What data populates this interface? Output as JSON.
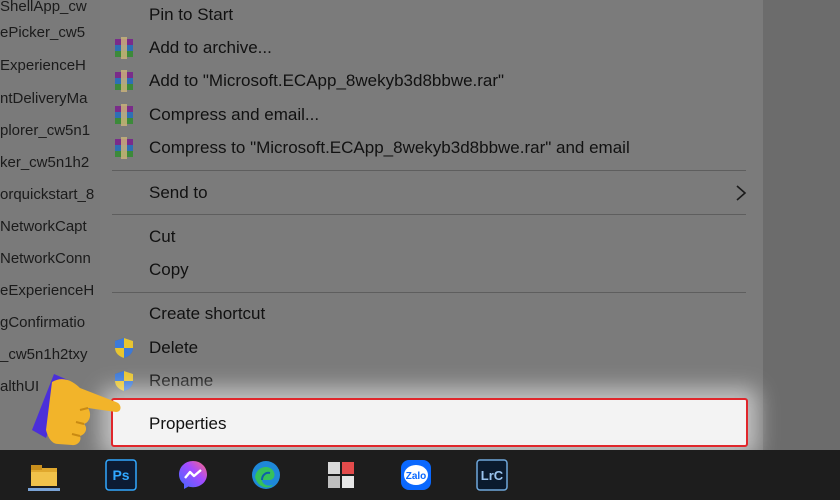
{
  "explorer": {
    "files": [
      "ShellApp_cw",
      "ePicker_cw5",
      "ExperienceH",
      "ntDeliveryMa",
      "plorer_cw5n1",
      "ker_cw5n1h2",
      "orquickstart_8",
      "NetworkCapt",
      "NetworkConn",
      "eExperienceH",
      "gConfirmatio",
      "_cw5n1h2txy",
      "althUI"
    ]
  },
  "context_menu": {
    "items": [
      {
        "label": "Pin to Start",
        "icon": "none"
      },
      {
        "label": "Add to archive...",
        "icon": "winrar-icon"
      },
      {
        "label": "Add to \"Microsoft.ECApp_8wekyb3d8bbwe.rar\"",
        "icon": "winrar-icon"
      },
      {
        "label": "Compress and email...",
        "icon": "winrar-icon"
      },
      {
        "label": "Compress to \"Microsoft.ECApp_8wekyb3d8bbwe.rar\" and email",
        "icon": "winrar-icon"
      },
      {
        "label": "Send to",
        "icon": "none",
        "submenu": true
      },
      {
        "label": "Cut",
        "icon": "none"
      },
      {
        "label": "Copy",
        "icon": "none"
      },
      {
        "label": "Create shortcut",
        "icon": "none"
      },
      {
        "label": "Delete",
        "icon": "uac-shield-icon"
      },
      {
        "label": "Rename",
        "icon": "uac-shield-icon"
      }
    ],
    "highlighted": {
      "label": "Properties"
    }
  },
  "taskbar": {
    "icons": [
      "file-explorer-icon",
      "photoshop-icon",
      "messenger-icon",
      "edge-icon",
      "app-grid-icon",
      "zalo-icon",
      "lightroom-classic-icon"
    ],
    "labels": {
      "photoshop": "Ps",
      "zalo": "Zalo",
      "lightroom": "LrC"
    }
  },
  "colors": {
    "highlight_border": "#e0262b",
    "pointer_hand": "#f2b42a",
    "pointer_cuff": "#4b2fd9"
  }
}
